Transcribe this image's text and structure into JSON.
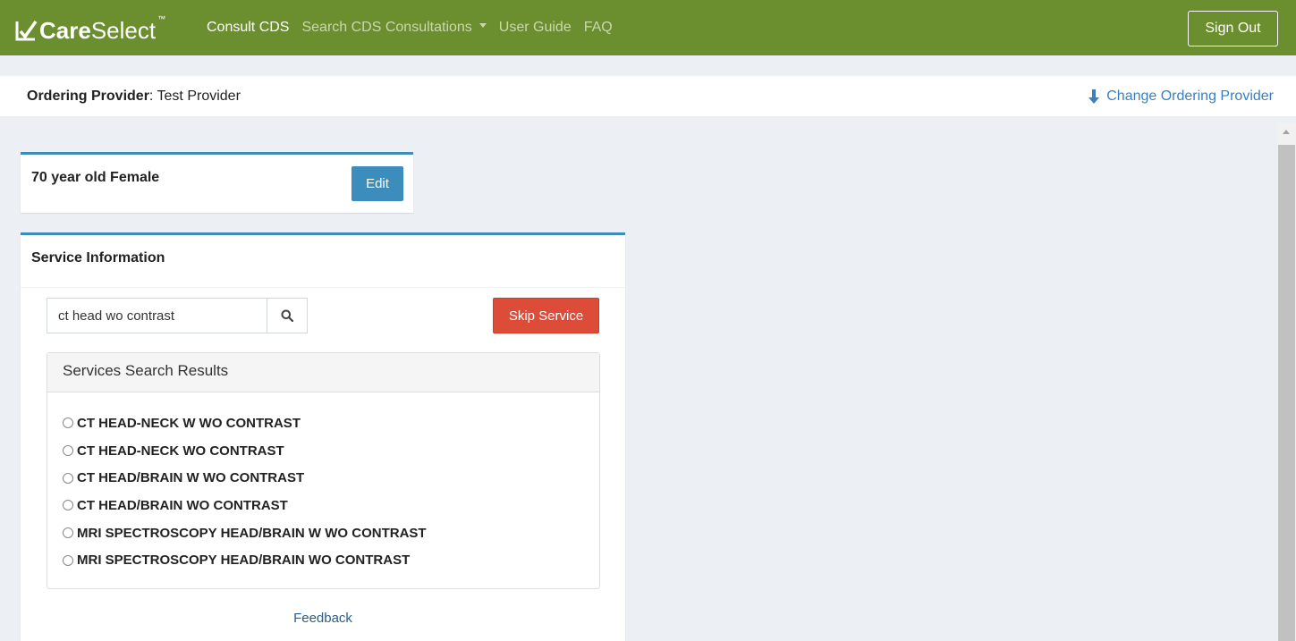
{
  "navbar": {
    "logo_care": "Care",
    "logo_select": "Select",
    "logo_tm": "™",
    "links": [
      "Consult CDS",
      "Search CDS Consultations",
      "User Guide",
      "FAQ"
    ],
    "sign_out": "Sign Out",
    "color": "#6b8e2e"
  },
  "provider": {
    "label": "Ordering Provider",
    "name": ": Test Provider",
    "change_link": "Change Ordering Provider"
  },
  "patient": {
    "summary": "70 year old Female",
    "edit_label": "Edit"
  },
  "service": {
    "title": "Service Information",
    "search_value": "ct head wo contrast",
    "skip_label": "Skip Service",
    "results_title": "Services Search Results",
    "results": [
      "CT HEAD-NECK W WO CONTRAST",
      "CT HEAD-NECK WO CONTRAST",
      "CT HEAD/BRAIN W WO CONTRAST",
      "CT HEAD/BRAIN WO CONTRAST",
      "MRI SPECTROSCOPY HEAD/BRAIN W WO CONTRAST",
      "MRI SPECTROSCOPY HEAD/BRAIN WO CONTRAST"
    ],
    "feedback": "Feedback"
  },
  "icons": [
    "checkmark-logo-icon",
    "chevron-down-icon",
    "arrow-down-icon",
    "search-icon",
    "radio-icon"
  ]
}
